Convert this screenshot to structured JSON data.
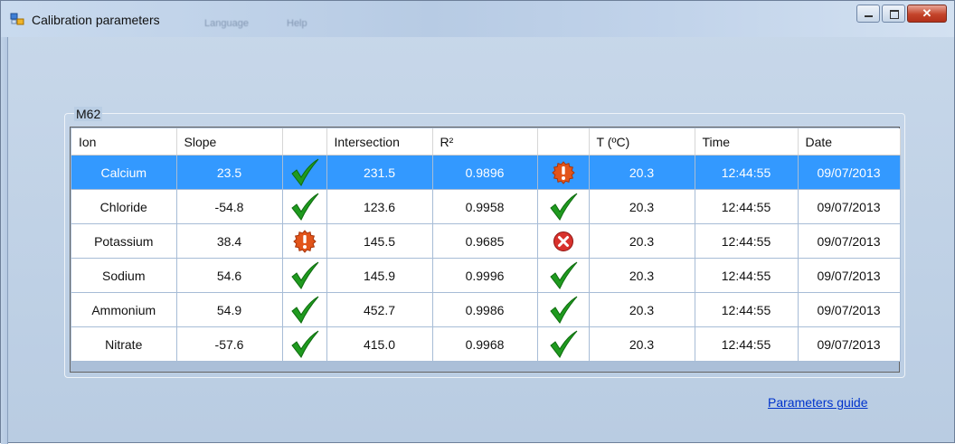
{
  "window": {
    "title": "Calibration parameters",
    "menu_ghost": [
      "Language",
      "Help"
    ]
  },
  "group": {
    "label": "M62"
  },
  "grid": {
    "columns": [
      "Ion",
      "Slope",
      "",
      "Intersection",
      "R²",
      "",
      "T (ºC)",
      "Time",
      "Date"
    ],
    "rows": [
      {
        "ion": "Calcium",
        "slope": "23.5",
        "slope_status": "ok",
        "intersection": "231.5",
        "r2": "0.9896",
        "r2_status": "warning",
        "temp": "20.3",
        "time": "12:44:55",
        "date": "09/07/2013",
        "selected": true
      },
      {
        "ion": "Chloride",
        "slope": "-54.8",
        "slope_status": "ok",
        "intersection": "123.6",
        "r2": "0.9958",
        "r2_status": "ok",
        "temp": "20.3",
        "time": "12:44:55",
        "date": "09/07/2013",
        "selected": false
      },
      {
        "ion": "Potassium",
        "slope": "38.4",
        "slope_status": "warning",
        "intersection": "145.5",
        "r2": "0.9685",
        "r2_status": "error",
        "temp": "20.3",
        "time": "12:44:55",
        "date": "09/07/2013",
        "selected": false
      },
      {
        "ion": "Sodium",
        "slope": "54.6",
        "slope_status": "ok",
        "intersection": "145.9",
        "r2": "0.9996",
        "r2_status": "ok",
        "temp": "20.3",
        "time": "12:44:55",
        "date": "09/07/2013",
        "selected": false
      },
      {
        "ion": "Ammonium",
        "slope": "54.9",
        "slope_status": "ok",
        "intersection": "452.7",
        "r2": "0.9986",
        "r2_status": "ok",
        "temp": "20.3",
        "time": "12:44:55",
        "date": "09/07/2013",
        "selected": false
      },
      {
        "ion": "Nitrate",
        "slope": "-57.6",
        "slope_status": "ok",
        "intersection": "415.0",
        "r2": "0.9968",
        "r2_status": "ok",
        "temp": "20.3",
        "time": "12:44:55",
        "date": "09/07/2013",
        "selected": false
      }
    ]
  },
  "link": {
    "label": "Parameters guide"
  },
  "icons": {
    "ok": "checkmark-icon",
    "warning": "warning-icon",
    "error": "error-icon",
    "minimize": "minimize-icon",
    "maximize": "maximize-icon",
    "close": "close-icon",
    "app": "app-icon"
  },
  "colors": {
    "selection": "#3399ff",
    "ok": "#1f9a1f",
    "warning": "#e2541a",
    "error": "#d8322d",
    "link": "#0033cc"
  }
}
